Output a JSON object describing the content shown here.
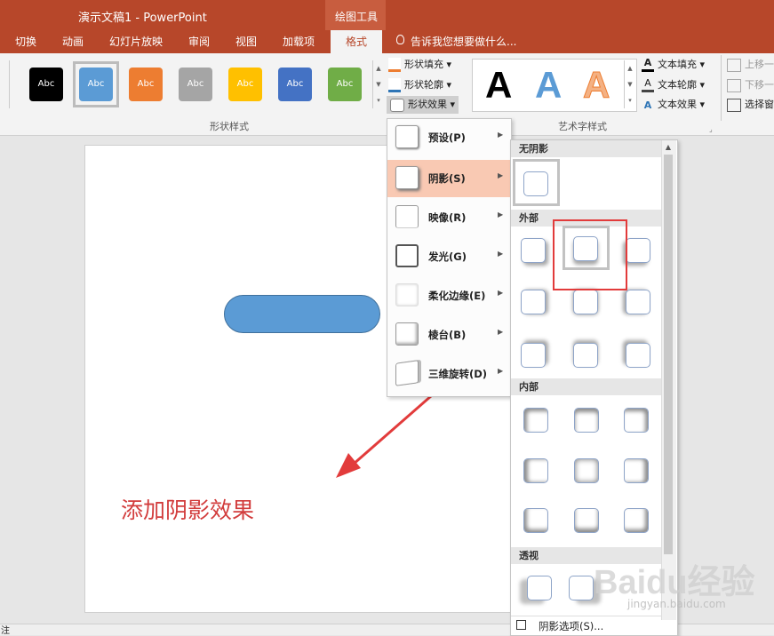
{
  "title": {
    "document": "演示文稿1 - PowerPoint",
    "context_tab": "绘图工具"
  },
  "tabs": [
    "切换",
    "动画",
    "幻灯片放映",
    "审阅",
    "视图",
    "加载项",
    "格式"
  ],
  "active_tab": "格式",
  "tell_me": "告诉我您想要做什么...",
  "ribbon": {
    "shape_styles": {
      "swatches": [
        {
          "label": "Abc",
          "color": "#000000"
        },
        {
          "label": "Abc",
          "color": "#5b9bd5"
        },
        {
          "label": "Abc",
          "color": "#ed7d31"
        },
        {
          "label": "Abc",
          "color": "#a5a5a5"
        },
        {
          "label": "Abc",
          "color": "#ffc000"
        },
        {
          "label": "Abc",
          "color": "#4472c4"
        },
        {
          "label": "Abc",
          "color": "#70ad47"
        }
      ],
      "fill": "形状填充",
      "outline": "形状轮廓",
      "effects": "形状效果",
      "group_label": "形状样式"
    },
    "wordart": {
      "letters": [
        "A",
        "A",
        "A"
      ],
      "text_fill": "文本填充",
      "text_outline": "文本轮廓",
      "text_effects": "文本效果",
      "group_label": "艺术字样式"
    },
    "arrange": {
      "bring_forward": "上移一",
      "send_backward": "下移一",
      "selection_pane": "选择窗"
    }
  },
  "effects_menu": [
    {
      "label": "预设(P)"
    },
    {
      "label": "阴影(S)",
      "highlighted": true
    },
    {
      "label": "映像(R)"
    },
    {
      "label": "发光(G)"
    },
    {
      "label": "柔化边缘(E)"
    },
    {
      "label": "棱台(B)"
    },
    {
      "label": "三维旋转(D)"
    }
  ],
  "shadow_gallery": {
    "sections": [
      "无阴影",
      "外部",
      "内部",
      "透视"
    ],
    "options_label": "阴影选项(S)..."
  },
  "annotation": "添加阴影效果",
  "status_text": "注",
  "watermark": {
    "logo": "Baidu经验",
    "url": "jingyan.baidu.com"
  },
  "colors": {
    "accent": "#b7472a",
    "highlight": "#f9c9b3",
    "annotation": "#d23c3c"
  }
}
